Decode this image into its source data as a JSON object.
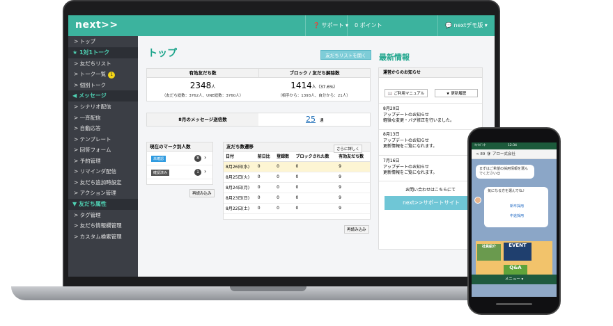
{
  "header": {
    "logo": "next>>",
    "support": "❓ サポート ▾",
    "points": "0 ポイント",
    "user": "💬 nextデモ版 ▾"
  },
  "sidebar": {
    "items": [
      {
        "label": "> トップ",
        "type": "item"
      },
      {
        "label": "★ 1対1トーク",
        "type": "section"
      },
      {
        "label": "> 友だちリスト",
        "type": "item"
      },
      {
        "label": "> トーク一覧",
        "type": "item",
        "badge": "1"
      },
      {
        "label": "> 個別トーク",
        "type": "item"
      },
      {
        "label": "◀ メッセージ",
        "type": "section"
      },
      {
        "label": "> シナリオ配信",
        "type": "item"
      },
      {
        "label": "> 一斉配信",
        "type": "item"
      },
      {
        "label": "> 自動応答",
        "type": "item"
      },
      {
        "label": "> テンプレート",
        "type": "item"
      },
      {
        "label": "> 回答フォーム",
        "type": "item"
      },
      {
        "label": "> 予約管理",
        "type": "item"
      },
      {
        "label": "> リマインダ配信",
        "type": "item"
      },
      {
        "label": "> 友だち追加時設定",
        "type": "item"
      },
      {
        "label": "> アクション管理",
        "type": "item"
      },
      {
        "label": "▼ 友だち属性",
        "type": "section"
      },
      {
        "label": "> タグ管理",
        "type": "item"
      },
      {
        "label": "> 友だち情報欄管理",
        "type": "item"
      },
      {
        "label": "> カスタム検索管理",
        "type": "item"
      }
    ]
  },
  "main": {
    "title": "トップ",
    "friends_list_button": "友だちリストを開く",
    "stats": {
      "friends_label": "有効友だち数",
      "friends_value": "2348",
      "friends_unit": "人",
      "friends_sub": "（友だち総数：3762人、UNE総数：3760人）",
      "blocked_label": "ブロック / 友だち解除数",
      "blocked_value": "1414",
      "blocked_unit": "人（37.6%）",
      "blocked_sub": "（相手から：1393人、自分から：21人）"
    },
    "messages": {
      "label": "8月のメッセージ送信数",
      "value": "25",
      "unit": "通"
    },
    "marks": {
      "title": "現在のマーク別人数",
      "rows": [
        {
          "tag": "未確認",
          "color": "#2f9be0",
          "count": "8"
        },
        {
          "tag": "確認済み",
          "color": "#555555",
          "count": "1"
        }
      ],
      "reload": "再読み込み"
    },
    "trend": {
      "title": "友だち数遷移",
      "more": "さらに詳しく",
      "headers": [
        "日付",
        "前日比",
        "登録数",
        "ブロックされた数",
        "有効友だち数"
      ],
      "rows": [
        [
          "8月26日(水)",
          "0",
          "0",
          "0",
          "9"
        ],
        [
          "8月25日(火)",
          "0",
          "0",
          "0",
          "9"
        ],
        [
          "8月24日(月)",
          "0",
          "0",
          "0",
          "9"
        ],
        [
          "8月23日(日)",
          "0",
          "0",
          "0",
          "9"
        ],
        [
          "8月22日(土)",
          "0",
          "0",
          "0",
          "9"
        ]
      ],
      "reload": "再読み込み"
    }
  },
  "news": {
    "title": "最新情報",
    "panel_title": "運営からのお知らせ",
    "manual_button": "📖 ご利用マニュアル",
    "history_button": "★ 更新履歴",
    "entries": [
      {
        "date": "8月20日",
        "title": "アップデートのお知らせ",
        "body": "軽微な変更・バグ修正を行いました。"
      },
      {
        "date": "8月13日",
        "title": "アップデートのお知らせ",
        "body": "更新情報をご覧になれます。"
      },
      {
        "date": "7月16日",
        "title": "アップデートのお知らせ",
        "body": "更新情報をご覧になれます。"
      }
    ],
    "contact": "お問い合わせはこちらにて",
    "support_button": "next>>サポートサイト"
  },
  "phone": {
    "status_left": "ｿﾌﾄﾊﾞﾝｸ",
    "time": "12:34",
    "chat_title": "< 89  🛡 アロー式会社",
    "bubble1": "まずはご希望の採用情報を選んでください😊",
    "bubble2": "気になる方を選んでね♪",
    "option1": "新卒採用",
    "option2": "中途採用",
    "menu_tiles": [
      "社員紹介",
      "EVENT",
      "Q&A"
    ],
    "menu_bar": "メニュー ▾"
  }
}
